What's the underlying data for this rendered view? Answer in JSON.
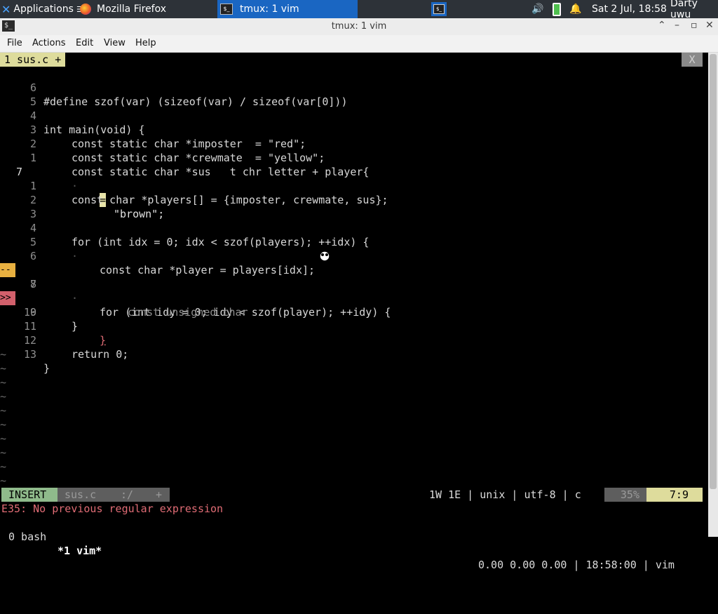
{
  "panel": {
    "applications": "Applications",
    "firefox_label": "Mozilla Firefox",
    "tmux_label": "tmux: 1 vim",
    "clock": "Sat  2 Jul, 18:58",
    "user": "Darty uwu"
  },
  "window": {
    "title": "tmux: 1 vim"
  },
  "menu": {
    "file": "File",
    "actions": "Actions",
    "edit": "Edit",
    "view": "View",
    "help": "Help"
  },
  "tabline": {
    "tab": "1 sus.c +",
    "close": "X"
  },
  "editor": {
    "line_numbers": [
      "6",
      "5",
      "4",
      "3",
      "2",
      "1",
      "7",
      "1",
      "2",
      "3",
      "4",
      "5",
      "6",
      "7",
      "8",
      "9",
      "10",
      "11",
      "12",
      "13"
    ],
    "code": {
      "l1": "#define szof(var) (sizeof(var) / sizeof(var[0]))",
      "l3": "int main(void) {",
      "l4": "const static char *imposter  = \"red\";",
      "l5": "const static char *crewmate  = \"yellow\";",
      "l6": "const static char *sus   t chr letter + player{",
      "l7": "\"brown\";",
      "l8": "const char *players[] = {imposter, crewmate, sus};",
      "l11": "for (int idx = 0; idx < szof(players); ++idx) {",
      "l12": "const char *player = players[idx];",
      "l14": "for (int idy = 0; idy < szof(player); ++idy) {",
      "l15": "const unsigned char",
      "l17": "}",
      "l19": "return 0;",
      "l20": "}"
    },
    "signs": {
      "changed": "--",
      "error": ">>"
    },
    "tilde": "~"
  },
  "statusline": {
    "mode": "INSERT",
    "file": "sus.c",
    "path": ":/",
    "modified": "+",
    "info": "1W 1E | unix | utf-8 | c",
    "percent": "35%",
    "position": "7:9"
  },
  "message": "E35: No previous regular expression",
  "tmux": {
    "bash": "0 bash",
    "vim": "*1 vim*",
    "right": "0.00 0.00 0.00 | 18:58:00 | vim"
  },
  "colors": {
    "accent": "#1a66c2",
    "insert": "#8fba8b",
    "tab": "#dedc9c",
    "error": "#e06c75"
  }
}
